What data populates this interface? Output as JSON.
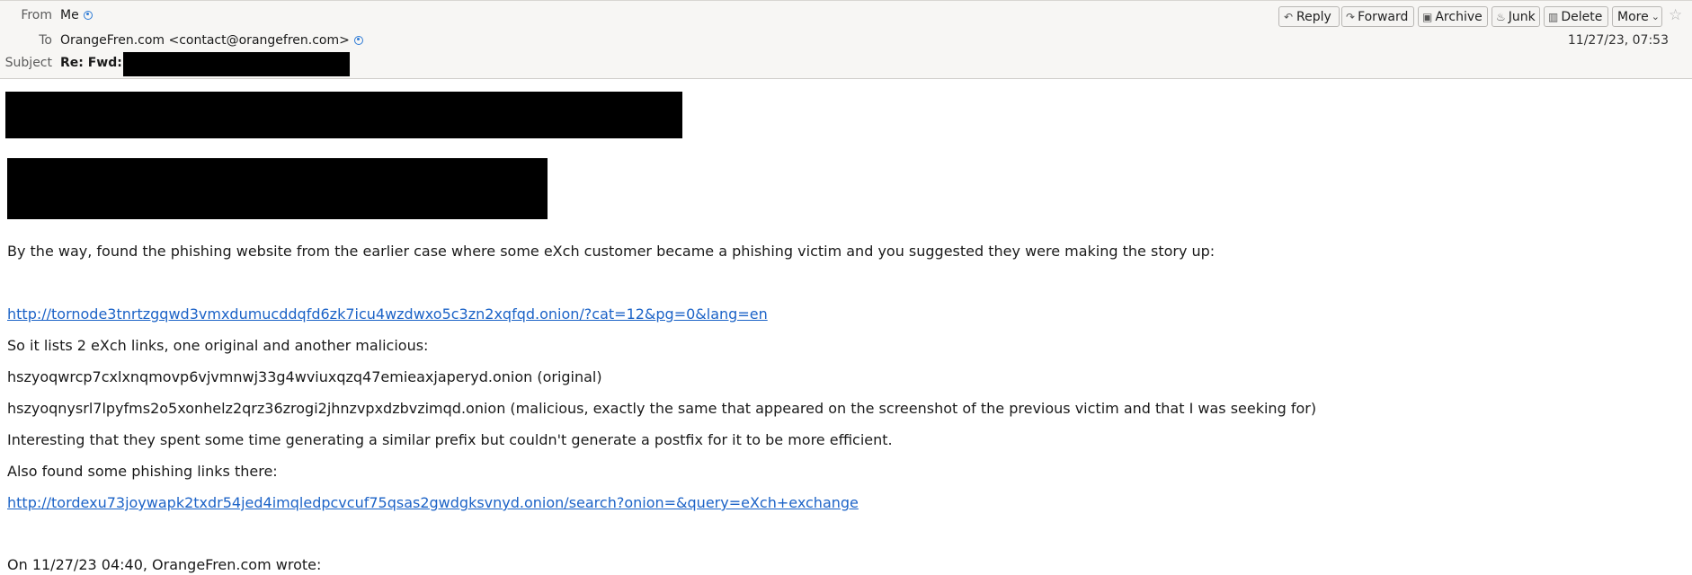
{
  "header": {
    "from_label": "From",
    "from_value": "Me",
    "to_label": "To",
    "to_value": "OrangeFren.com <contact@orangefren.com>",
    "subject_label": "Subject",
    "subject_value": "Re: Fwd:",
    "date": "11/27/23, 07:53"
  },
  "toolbar": {
    "reply": "Reply",
    "forward": "Forward",
    "archive": "Archive",
    "junk": "Junk",
    "delete": "Delete",
    "more": "More"
  },
  "icons": {
    "reply": "reply-arrow-icon",
    "forward": "forward-arrow-icon",
    "archive": "archive-box-icon",
    "junk": "junk-flame-icon",
    "delete": "trash-icon",
    "more": "chevron-down-icon",
    "star": "star-icon",
    "contact": "contact-card-icon"
  },
  "body": {
    "line1": "By the way, found the phishing website from the earlier case where some eXch customer became a phishing victim and you suggested they were making the story up:",
    "link1": "http://tornode3tnrtzgqwd3vmxdumucddqfd6zk7icu4wzdwxo5c3zn2xqfqd.onion/?cat=12&pg=0&lang=en",
    "line2": "So it lists 2 eXch links, one original and another malicious:",
    "line3": "hszyoqwrcp7cxlxnqmovp6vjvmnwj33g4wviuxqzq47emieaxjaperyd.onion (original)",
    "line4": "hszyoqnysrl7lpyfms2o5xonhelz2qrz36zrogi2jhnzvpxdzbvzimqd.onion (malicious, exactly the same that appeared on the screenshot of the previous victim and that I was seeking for)",
    "line5": "Interesting that they spent some time generating a similar prefix but couldn't generate a postfix for it to be more efficient.",
    "line6": "Also found some phishing links there:",
    "link2": "http://tordexu73joywapk2txdr54jed4imqledpcvcuf75qsas2gwdgksvnyd.onion/search?onion=&query=eXch+exchange",
    "quote_header": "On 11/27/23 04:40, OrangeFren.com wrote:"
  }
}
